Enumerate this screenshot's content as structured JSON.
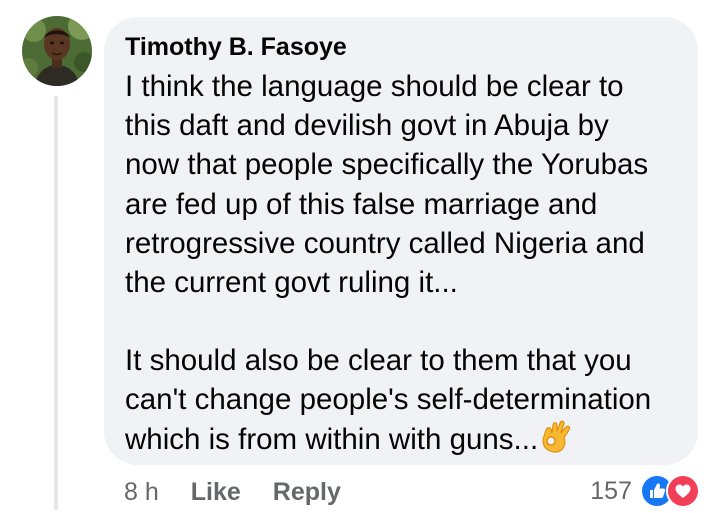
{
  "comment": {
    "author": "Timothy B. Fasoye",
    "paragraphs": [
      "I think the language should be clear to\nthis daft and devilish govt in Abuja by\nnow that people specifically the Yorubas\nare fed up of this false marriage and\nretrogressive country called Nigeria and\nthe current govt ruling it...",
      "It should also be clear to them that you\ncan't change people's self-determination\nwhich is from within with guns..."
    ],
    "trailing_emoji": "ok-hand-icon",
    "time": "8 h",
    "like_label": "Like",
    "reply_label": "Reply",
    "reaction_count": "157",
    "reaction_icons": [
      "like-icon",
      "love-icon"
    ]
  },
  "colors": {
    "bubble_bg": "#f0f2f5",
    "text": "#050505",
    "secondary_text": "#65676b",
    "like_blue": "#1877f2",
    "love_red": "#f33e58",
    "thread_line": "#e4e6eb"
  }
}
